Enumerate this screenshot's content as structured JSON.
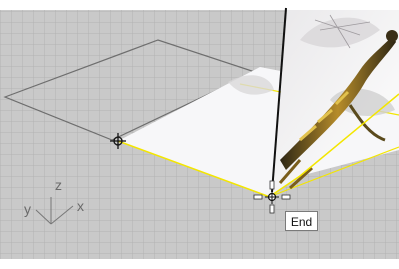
{
  "viewport": {
    "background_color": "#c9c9c9",
    "grid_line_color": "#b3b3b3",
    "major_line_color": "#6e6e6e",
    "selection_color": "#f3e600",
    "object_colors": {
      "plane_surface": "#f7f7f9",
      "object_line": "#111111"
    }
  },
  "axis_widget": {
    "z_label": "z",
    "y_label": "y",
    "x_label": "x"
  },
  "osnap_tooltip": {
    "text": "End"
  },
  "icons": {
    "cursor": "crosshair-cursor-icon",
    "snap_marker": "snap-target-icon"
  }
}
